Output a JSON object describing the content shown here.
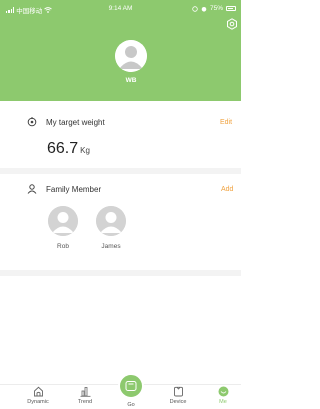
{
  "status_bar": {
    "carrier": "中国移动",
    "time": "9:14 AM",
    "battery": "75%"
  },
  "profile": {
    "name": "WB",
    "settings_icon": "settings-icon"
  },
  "target_weight": {
    "title": "My target weight",
    "action": "Edit",
    "value": "66.7",
    "unit": "Kg"
  },
  "family": {
    "title": "Family Member",
    "action": "Add",
    "members": [
      {
        "name": "Rob"
      },
      {
        "name": "James"
      }
    ]
  },
  "tabs": [
    {
      "label": "Dynamic",
      "icon": "home-icon"
    },
    {
      "label": "Trend",
      "icon": "bar-chart-icon"
    },
    {
      "label": "Go",
      "icon": "scale-icon"
    },
    {
      "label": "Device",
      "icon": "device-icon"
    },
    {
      "label": "Me",
      "icon": "smile-icon"
    }
  ],
  "colors": {
    "accent": "#8dc96e",
    "action": "#f0a23f"
  }
}
